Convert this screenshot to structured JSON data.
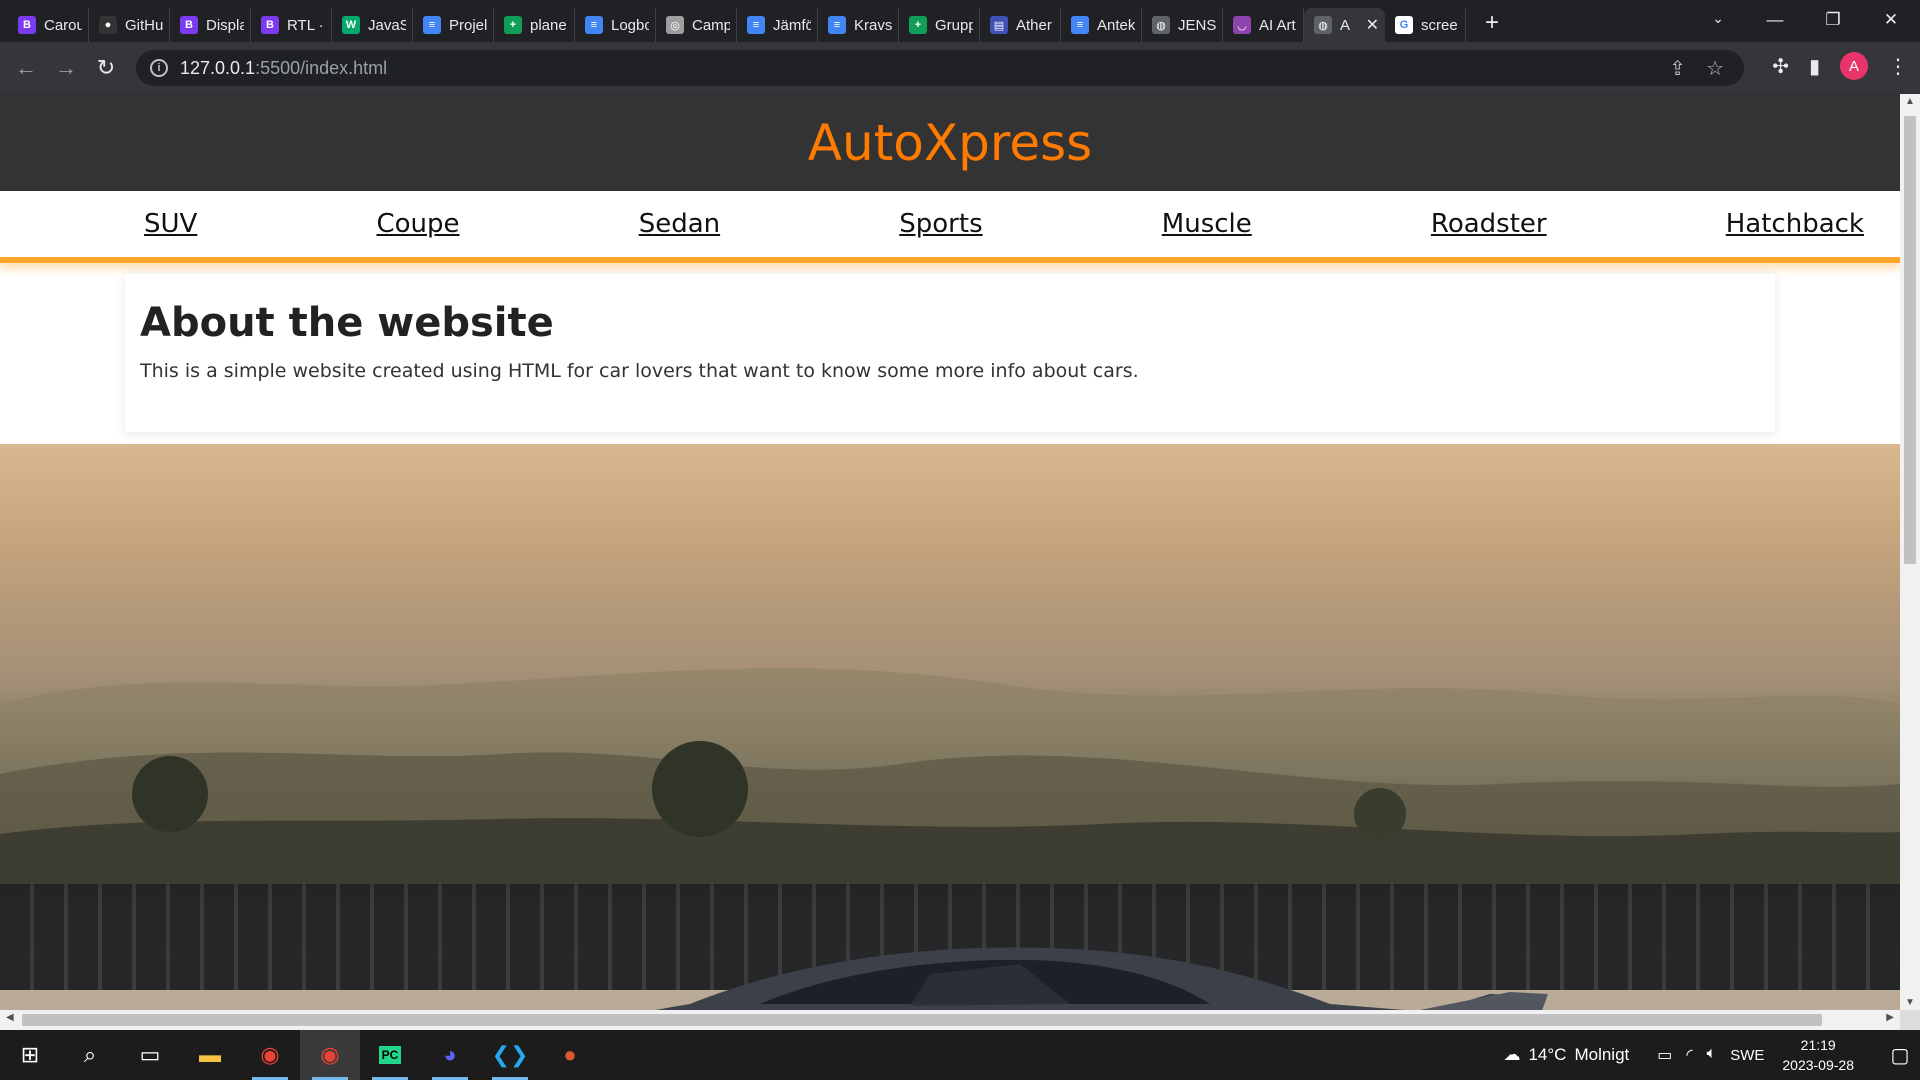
{
  "browser": {
    "tabs": [
      {
        "label": "Carou",
        "icon": "bootstrap-icon",
        "icon_letter": "B",
        "color": "#7a3bf0"
      },
      {
        "label": "GitHu",
        "icon": "github-icon",
        "icon_letter": "●",
        "color": "#333333"
      },
      {
        "label": "Displa",
        "icon": "bootstrap-icon",
        "icon_letter": "B",
        "color": "#7a3bf0"
      },
      {
        "label": "RTL · l",
        "icon": "bootstrap-icon",
        "icon_letter": "B",
        "color": "#7a3bf0"
      },
      {
        "label": "JavaS",
        "icon": "w3schools-icon",
        "icon_letter": "W",
        "color": "#04aa6d"
      },
      {
        "label": "Projel",
        "icon": "google-docs-icon",
        "icon_letter": "≡",
        "color": "#4285f4"
      },
      {
        "label": "plane",
        "icon": "google-sheets-icon",
        "icon_letter": "+",
        "color": "#0f9d58"
      },
      {
        "label": "Logbo",
        "icon": "google-docs-icon",
        "icon_letter": "≡",
        "color": "#4285f4"
      },
      {
        "label": "Camp",
        "icon": "campus-icon",
        "icon_letter": "◎",
        "color": "#9e9e9e"
      },
      {
        "label": "Jämfö",
        "icon": "google-docs-icon",
        "icon_letter": "≡",
        "color": "#4285f4"
      },
      {
        "label": "Kravsp",
        "icon": "google-docs-icon",
        "icon_letter": "≡",
        "color": "#4285f4"
      },
      {
        "label": "Grupp",
        "icon": "google-sheets-icon",
        "icon_letter": "+",
        "color": "#0f9d58"
      },
      {
        "label": "Ather",
        "icon": "forms-icon",
        "icon_letter": "▤",
        "color": "#3f51b5"
      },
      {
        "label": "Antek",
        "icon": "google-docs-icon",
        "icon_letter": "≡",
        "color": "#4285f4"
      },
      {
        "label": "JENSE",
        "icon": "globe-icon",
        "icon_letter": "◍",
        "color": "#5f6368"
      },
      {
        "label": "AI Art",
        "icon": "ai-art-icon",
        "icon_letter": "◡",
        "color": "#8e44ad"
      },
      {
        "label": "A",
        "icon": "globe-icon",
        "icon_letter": "◍",
        "color": "#5f6368",
        "active": true
      },
      {
        "label": "scree",
        "icon": "google-icon",
        "icon_letter": "G",
        "color": "#ffffff"
      }
    ],
    "close_glyph": "✕",
    "newtab_glyph": "+",
    "tabsearch_glyph": "⌄",
    "window_controls": {
      "minimize": "—",
      "restore": "❐",
      "close": "✕"
    },
    "address": {
      "host": "127.0.0.1",
      "path": ":5500/index.html"
    }
  },
  "site": {
    "title": "AutoXpress",
    "nav": [
      "SUV",
      "Coupe",
      "Sedan",
      "Sports",
      "Muscle",
      "Roadster",
      "Hatchback"
    ],
    "about": {
      "heading": "About the website",
      "text": "This is a simple website created using HTML for car lovers that want to know some more info about cars."
    },
    "carousel": {
      "prev": "‹",
      "next": "›"
    },
    "accent_color": "#ff7a00"
  },
  "taskbar": {
    "weather": {
      "temp": "14°C",
      "condition": "Molnigt"
    },
    "language": "SWE",
    "time": "21:19",
    "date": "2023-09-28"
  }
}
